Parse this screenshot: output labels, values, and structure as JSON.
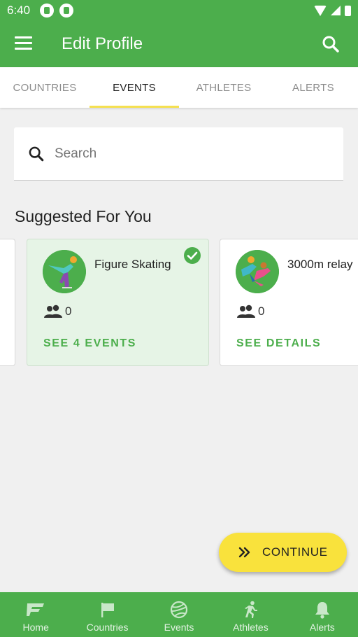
{
  "status_bar": {
    "time": "6:40"
  },
  "app_bar": {
    "title": "Edit Profile"
  },
  "tabs": [
    {
      "label": "COUNTRIES",
      "active": false
    },
    {
      "label": "EVENTS",
      "active": true
    },
    {
      "label": "ATHLETES",
      "active": false
    },
    {
      "label": "ALERTS",
      "active": false
    }
  ],
  "search": {
    "placeholder": "Search",
    "value": ""
  },
  "section": {
    "title": "Suggested For You"
  },
  "cards": [
    {
      "name": "Figure Skating",
      "count": "0",
      "action": "SEE 4 EVENTS",
      "selected": true,
      "icon": "figure-skating-icon"
    },
    {
      "name": "3000m relay",
      "count": "0",
      "action": "SEE DETAILS",
      "selected": false,
      "icon": "speed-skating-icon"
    }
  ],
  "fab": {
    "label": "CONTINUE",
    "icon": "double-chevron-right-icon"
  },
  "bottom_nav": [
    {
      "label": "Home",
      "icon": "home-logo-icon"
    },
    {
      "label": "Countries",
      "icon": "flag-icon"
    },
    {
      "label": "Events",
      "icon": "ball-icon"
    },
    {
      "label": "Athletes",
      "icon": "runner-icon"
    },
    {
      "label": "Alerts",
      "icon": "bell-icon"
    }
  ],
  "colors": {
    "primary": "#4cae4c",
    "accent": "#f9e23c",
    "selected_card": "#e6f4e6",
    "tab_indicator": "#f5e050"
  }
}
